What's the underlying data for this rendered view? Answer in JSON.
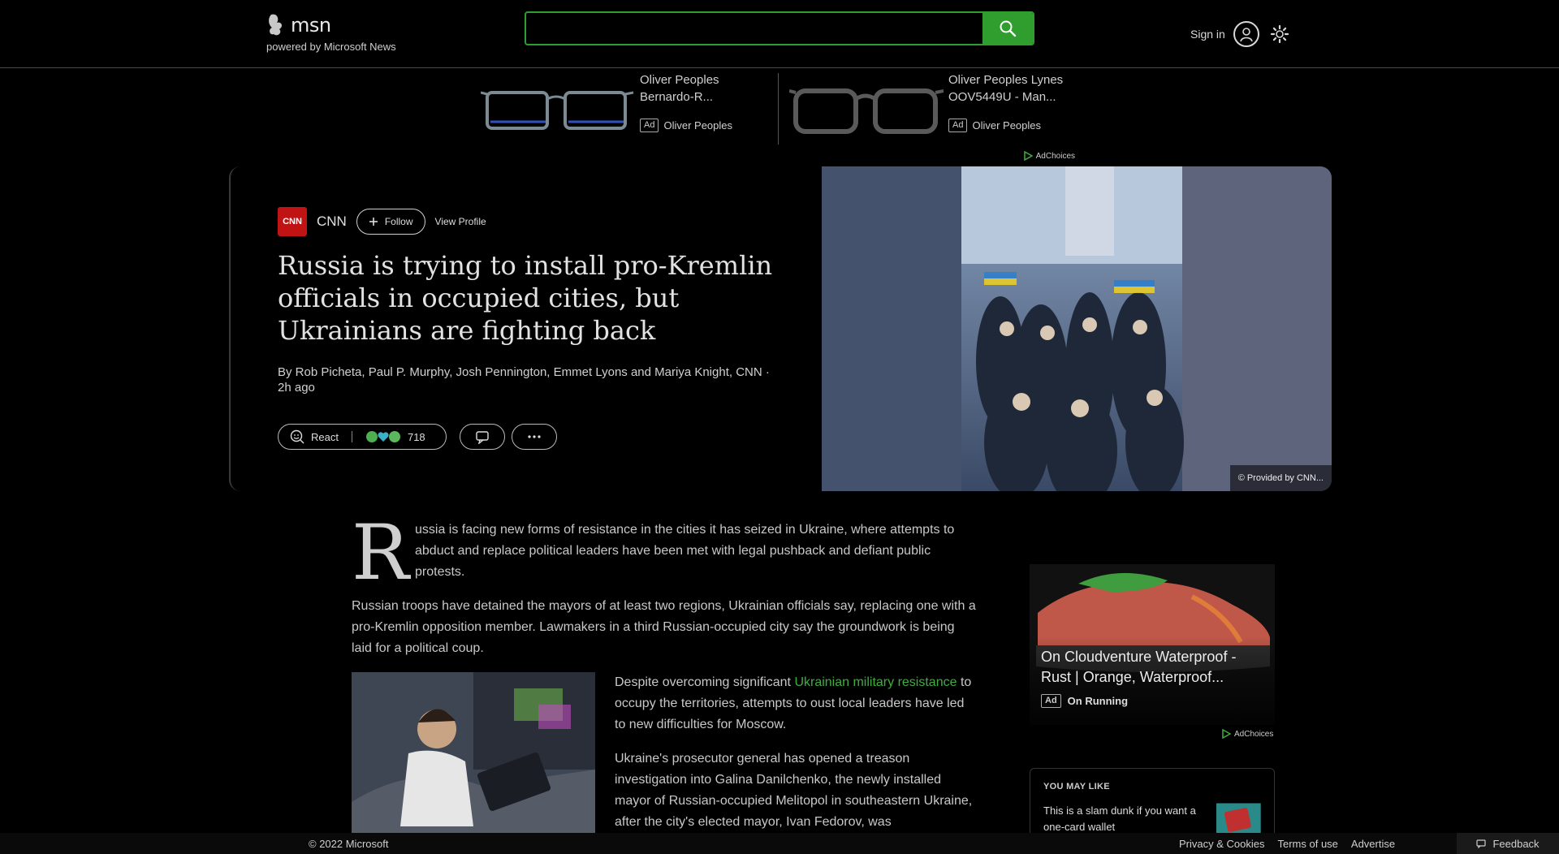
{
  "header": {
    "logo_text": "msn",
    "logo_sub": "powered by Microsoft News",
    "search_placeholder": "",
    "search_icon": "search-icon",
    "signin_label": "Sign in",
    "avatar_icon": "user-icon",
    "settings_icon": "gear-icon"
  },
  "top_ads": [
    {
      "title_line1": "Oliver Peoples",
      "title_line2": "Bernardo-R...",
      "badge": "Ad",
      "advertiser": "Oliver Peoples"
    },
    {
      "title_line1": "Oliver Peoples Lynes",
      "title_line2": "OOV5449U - Man...",
      "badge": "Ad",
      "advertiser": "Oliver Peoples"
    }
  ],
  "adchoices_label": "AdChoices",
  "hero": {
    "source_logo": "CNN",
    "source": "CNN",
    "follow_label": "Follow",
    "view_profile_label": "View Profile",
    "headline": "Russia is trying to install pro-Kremlin officials in occupied cities, but Ukrainians are fighting back",
    "byline": "By Rob Picheta, Paul P. Murphy, Josh Pennington, Emmet Lyons and Mariya Knight, CNN · 2h ago",
    "react_label": "React",
    "reaction_count": "718",
    "credit": "© Provided by CNN..."
  },
  "article": {
    "dropcap": "R",
    "para1": "ussia is facing new forms of resistance in the cities it has seized in Ukraine, where attempts to abduct and replace political leaders have been met with legal pushback and defiant public protests.",
    "para2": "Russian troops have detained the mayors of at least two regions, Ukrainian officials say, replacing one with a pro-Kremlin opposition member. Lawmakers in a third Russian-occupied city say the groundwork is being laid for a political coup.",
    "para3_before": "Despite overcoming significant ",
    "para3_link": "Ukrainian military resistance",
    "para3_after": " to occupy the territories, attempts to oust local leaders have led to new difficulties for Moscow.",
    "para4": "Ukraine's prosecutor general has opened a treason investigation into Galina Danilchenko, the newly installed mayor of Russian-occupied Melitopol in southeastern Ukraine, after the city's elected mayor, Ivan Fedorov, was"
  },
  "rail_ad": {
    "title": "On Cloudventure Waterproof - Rust | Orange, Waterproof...",
    "badge": "Ad",
    "advertiser": "On Running",
    "adchoices": "AdChoices"
  },
  "you_may_like": {
    "title": "YOU MAY LIKE",
    "item_text": "This is a slam dunk if you want a one-card wallet"
  },
  "footer": {
    "copyright": "© 2022 Microsoft",
    "links": [
      "Privacy & Cookies",
      "Terms of use",
      "Advertise"
    ],
    "feedback": "Feedback"
  },
  "colors": {
    "accent_green": "#2f9e2f",
    "link_green": "#3fae3f",
    "cnn_red": "#c01414"
  }
}
